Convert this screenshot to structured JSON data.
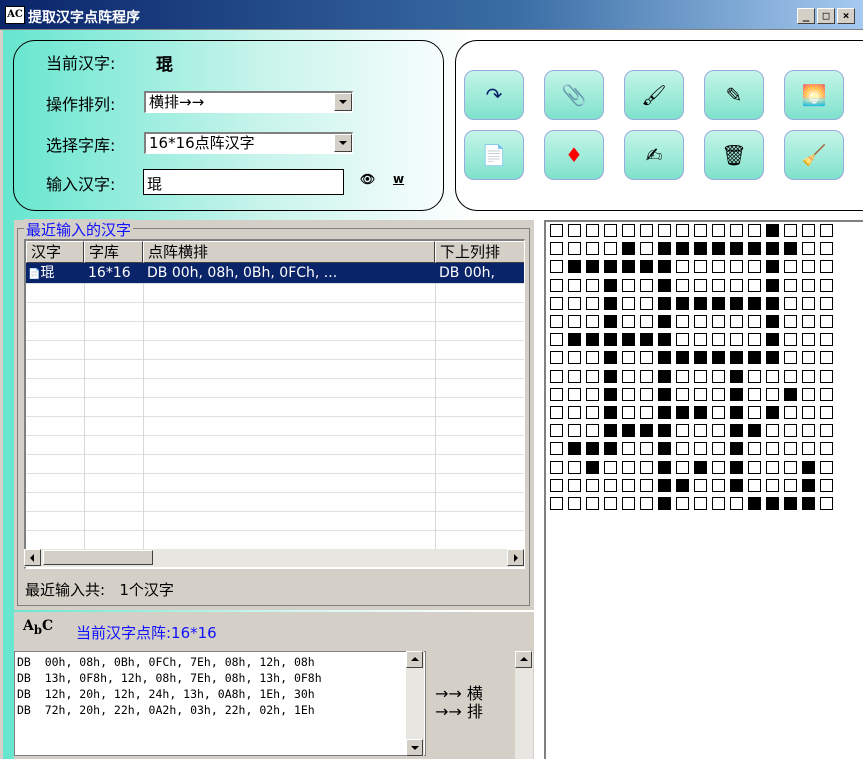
{
  "window": {
    "title": "提取汉字点阵程序",
    "min_label": "_",
    "max_label": "□",
    "close_label": "×"
  },
  "form": {
    "current_char_label": "当前汉字:",
    "current_char": "琨",
    "order_label": "操作排列:",
    "order_value": "横排→→",
    "font_label": "选择字库:",
    "font_value": "16*16点阵汉字",
    "input_label": "输入汉字:",
    "input_value": "琨",
    "binoculars_icon": "binoculars-icon",
    "w_label": "w"
  },
  "toolbar": {
    "buttons": [
      {
        "name": "redo-icon",
        "glyph": "↷"
      },
      {
        "name": "paperclip-icon",
        "glyph": "📎"
      },
      {
        "name": "paint-icon",
        "glyph": "🖌"
      },
      {
        "name": "pencil-icon",
        "glyph": "✎"
      },
      {
        "name": "picture-icon",
        "glyph": "🌅"
      },
      {
        "name": "copy-icon",
        "glyph": "📄"
      },
      {
        "name": "diamond-icon",
        "glyph": "♦"
      },
      {
        "name": "write-icon",
        "glyph": "✍"
      },
      {
        "name": "trash-icon",
        "glyph": "🗑"
      },
      {
        "name": "clear-icon",
        "glyph": "🧹"
      }
    ]
  },
  "recent": {
    "group_label": "最近输入的汉字",
    "columns": [
      "汉字",
      "字库",
      "点阵横排",
      "下上列排"
    ],
    "rows": [
      {
        "char": "琨",
        "font": "16*16",
        "horiz": "DB    00h,   08h,   0Bh,   0FCh,  ...",
        "vert": "DB    00h,"
      }
    ],
    "count_label": "最近输入共:",
    "count_value": "1个汉字"
  },
  "matrix": {
    "label": "当前汉字点阵:16*16",
    "code_lines": [
      "DB  00h, 08h, 0Bh, 0FCh, 7Eh, 08h, 12h, 08h",
      "DB  13h, 0F8h, 12h, 08h, 7Eh, 08h, 13h, 0F8h",
      "DB  12h, 20h, 12h, 24h, 13h, 0A8h, 1Eh, 30h",
      "DB  72h, 20h, 22h, 0A2h, 03h, 22h, 02h, 1Eh"
    ],
    "dir_line1": "→→  横",
    "dir_line2": "→→  排",
    "bytes": [
      "00",
      "08",
      "0B",
      "FC",
      "7E",
      "08",
      "12",
      "08",
      "13",
      "F8",
      "12",
      "08",
      "7E",
      "08",
      "13",
      "F8",
      "12",
      "20",
      "12",
      "24",
      "13",
      "A8",
      "1E",
      "30",
      "72",
      "20",
      "22",
      "A2",
      "03",
      "22",
      "02",
      "1E"
    ]
  }
}
